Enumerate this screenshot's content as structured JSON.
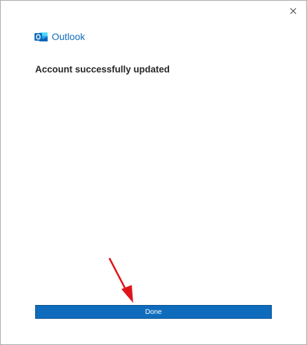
{
  "window": {
    "close_icon": "close-icon"
  },
  "brand": {
    "app_name": "Outlook",
    "icon": "outlook-logo-icon",
    "color": "#0f6cbd"
  },
  "main": {
    "heading": "Account successfully updated"
  },
  "footer": {
    "done_label": "Done",
    "button_color": "#0f6cbd"
  },
  "annotation": {
    "arrow_icon": "red-arrow-icon",
    "color": "#e0151b"
  }
}
